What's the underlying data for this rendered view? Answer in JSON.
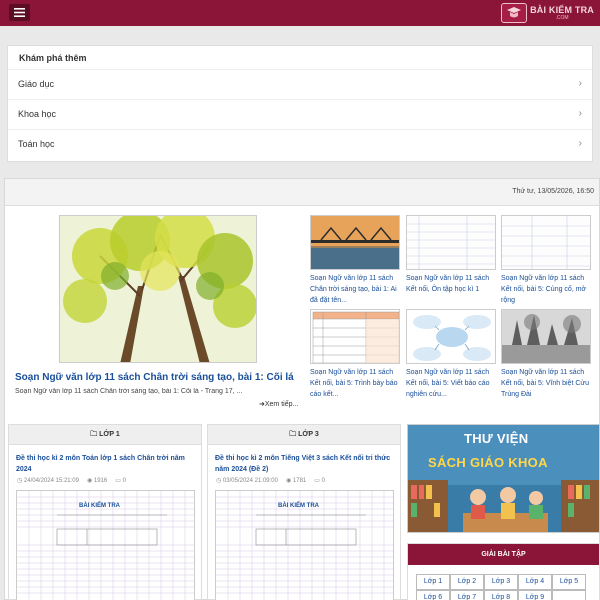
{
  "header": {
    "logo_main": "BÀI KIỂM TRA",
    "logo_sub": ".COM"
  },
  "explore": {
    "title": "Khám phá thêm",
    "items": [
      {
        "label": "Giáo dục"
      },
      {
        "label": "Khoa học"
      },
      {
        "label": "Toán học"
      }
    ]
  },
  "datebar": {
    "date": "Thứ tư, 13/05/2026, 16:50"
  },
  "featured": {
    "title": "Soạn Ngữ văn lớp 11 sách Chân trời sáng tạo, bài 1: Cõi lá",
    "desc": "Soạn Ngữ văn lớp 11 sách Chân trời sáng tạo, bài 1: Cõi lá - Trang 17, ...",
    "more": "Xem tiếp..."
  },
  "thumbs": [
    {
      "caption": "Soạn Ngữ văn lớp 11 sách Chân trời sáng tạo, bài 1: Ai đã đặt tên..."
    },
    {
      "caption": "Soạn Ngữ văn lớp 11 sách Kết nối, Ôn tập học kì 1"
    },
    {
      "caption": "Soạn Ngữ văn lớp 11 sách Kết nối, bài 5: Củng cố, mở rộng"
    },
    {
      "caption": "Soạn Ngữ văn lớp 11 sách Kết nối, bài 5: Trình bày báo cáo kết..."
    },
    {
      "caption": "Soạn Ngữ văn lớp 11 sách Kết nối, bài 5: Viết báo cáo nghiên cứu..."
    },
    {
      "caption": "Soạn Ngữ văn lớp 11 sách Kết nối, bài 5: Vĩnh biệt Cửu Trùng Đài"
    }
  ],
  "cards": [
    {
      "head": "LỚP 1",
      "title": "Đề thi học kì 2 môn Toán lớp 1 sách Chân trời năm 2024",
      "date": "24/04/2024 15:21:09",
      "views": "1916",
      "comments": "0",
      "img_title": "BÀI KIỂM TRA"
    },
    {
      "head": "LỚP 3",
      "title": "Đề thi học kì 2 môn Tiếng Việt 3 sách Kết nối tri thức năm 2024 (Đề 2)",
      "date": "03/05/2024 21:09:00",
      "views": "1781",
      "comments": "0",
      "img_title": "BÀI KIỂM TRA"
    }
  ],
  "banner": {
    "line1": "THƯ VIỆN",
    "line2": "SÁCH GIÁO KHOA"
  },
  "solve": {
    "title": "GIẢI BÀI TẬP",
    "grades": [
      "Lớp 1",
      "Lớp 2",
      "Lớp 3",
      "Lớp 4",
      "Lớp 5",
      "Lớp 6",
      "Lớp 7",
      "Lớp 8",
      "Lớp 9",
      ""
    ]
  },
  "colors": {
    "brand": "#8a1538",
    "link": "#1a4f99"
  }
}
